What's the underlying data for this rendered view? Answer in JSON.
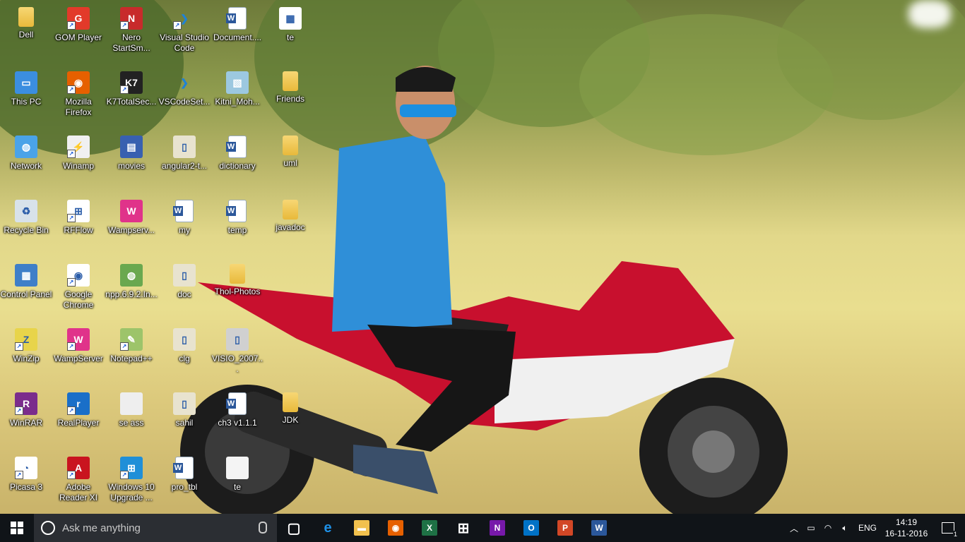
{
  "desktop": {
    "icons": [
      {
        "id": "dell",
        "label": "Dell",
        "icon": "folder-user-icon",
        "shortcut": false
      },
      {
        "id": "this-pc",
        "label": "This PC",
        "icon": "computer-icon",
        "shortcut": false
      },
      {
        "id": "network",
        "label": "Network",
        "icon": "network-icon",
        "shortcut": false
      },
      {
        "id": "recycle-bin",
        "label": "Recycle Bin",
        "icon": "recycle-bin-icon",
        "shortcut": false
      },
      {
        "id": "control-panel",
        "label": "Control Panel",
        "icon": "control-panel-icon",
        "shortcut": false
      },
      {
        "id": "winzip",
        "label": "WinZip",
        "icon": "winzip-icon",
        "shortcut": true
      },
      {
        "id": "winrar",
        "label": "WinRAR",
        "icon": "winrar-icon",
        "shortcut": true
      },
      {
        "id": "picasa",
        "label": "Picasa 3",
        "icon": "picasa-icon",
        "shortcut": true
      },
      {
        "id": "gom",
        "label": "GOM Player",
        "icon": "gom-player-icon",
        "shortcut": true
      },
      {
        "id": "firefox",
        "label": "Mozilla Firefox",
        "icon": "firefox-icon",
        "shortcut": true
      },
      {
        "id": "winamp",
        "label": "Winamp",
        "icon": "winamp-icon",
        "shortcut": true
      },
      {
        "id": "rfflow",
        "label": "RFFlow",
        "icon": "rfflow-icon",
        "shortcut": true
      },
      {
        "id": "chrome",
        "label": "Google Chrome",
        "icon": "chrome-icon",
        "shortcut": true
      },
      {
        "id": "wampserver",
        "label": "WampServer",
        "icon": "wampserver-icon",
        "shortcut": true
      },
      {
        "id": "realplayer",
        "label": "RealPlayer",
        "icon": "realplayer-icon",
        "shortcut": true
      },
      {
        "id": "adobe",
        "label": "Adobe Reader XI",
        "icon": "adobe-reader-icon",
        "shortcut": true
      },
      {
        "id": "nero",
        "label": "Nero StartSm...",
        "icon": "nero-icon",
        "shortcut": true
      },
      {
        "id": "k7",
        "label": "K7TotalSec...",
        "icon": "k7-icon",
        "shortcut": true
      },
      {
        "id": "movies",
        "label": "movies",
        "icon": "mkv-file-icon",
        "shortcut": false
      },
      {
        "id": "wampserv2",
        "label": "Wampserv...",
        "icon": "wampserver-icon",
        "shortcut": false
      },
      {
        "id": "npp-installer",
        "label": "npp.6.9.2.In...",
        "icon": "notepadpp-installer-icon",
        "shortcut": false
      },
      {
        "id": "notepadpp",
        "label": "Notepad++",
        "icon": "notepadpp-icon",
        "shortcut": true
      },
      {
        "id": "se-ass",
        "label": "se ass",
        "icon": "file-icon",
        "shortcut": false
      },
      {
        "id": "win10",
        "label": "Windows 10 Upgrade ...",
        "icon": "windows-upgrade-icon",
        "shortcut": true
      },
      {
        "id": "vscode",
        "label": "Visual Studio Code",
        "icon": "vscode-icon",
        "shortcut": true
      },
      {
        "id": "vscodeset",
        "label": "VSCodeSet...",
        "icon": "vscode-icon",
        "shortcut": false
      },
      {
        "id": "angular",
        "label": "angular2-t...",
        "icon": "zip-file-icon",
        "shortcut": false
      },
      {
        "id": "my",
        "label": "my",
        "icon": "word-doc-icon",
        "shortcut": false
      },
      {
        "id": "doc",
        "label": "doc",
        "icon": "zip-file-icon",
        "shortcut": false
      },
      {
        "id": "clg",
        "label": "clg",
        "icon": "zip-file-icon",
        "shortcut": false
      },
      {
        "id": "sahil",
        "label": "sahil",
        "icon": "zip-file-icon",
        "shortcut": false
      },
      {
        "id": "pro-tbl",
        "label": "pro_tbl",
        "icon": "vscode-file-icon",
        "shortcut": false
      },
      {
        "id": "document",
        "label": "Document....",
        "icon": "word-doc-icon",
        "shortcut": false
      },
      {
        "id": "kitni",
        "label": "Kitni_Moh...",
        "icon": "image-file-icon",
        "shortcut": false
      },
      {
        "id": "dictionary",
        "label": "dictionary",
        "icon": "word-doc-icon",
        "shortcut": false
      },
      {
        "id": "temp",
        "label": "temp",
        "icon": "word-doc-icon",
        "shortcut": false
      },
      {
        "id": "thol",
        "label": "Thol-Photos",
        "icon": "zip-folder-icon",
        "shortcut": false
      },
      {
        "id": "visio",
        "label": "VISIO_2007...",
        "icon": "installer-icon",
        "shortcut": false
      },
      {
        "id": "ch3",
        "label": "ch3 v1.1.1",
        "icon": "word-doc-icon",
        "shortcut": false
      },
      {
        "id": "te-file",
        "label": "te",
        "icon": "blank-file-icon",
        "shortcut": false
      },
      {
        "id": "te-img",
        "label": "te",
        "icon": "image-thumbnail-icon",
        "shortcut": false
      },
      {
        "id": "friends",
        "label": "Friends",
        "icon": "folder-icon",
        "shortcut": false
      },
      {
        "id": "uml",
        "label": "uml",
        "icon": "folder-icon",
        "shortcut": false
      },
      {
        "id": "javadoc",
        "label": "javadoc",
        "icon": "folder-icon",
        "shortcut": false
      },
      {
        "id": "jdk",
        "label": "JDK",
        "icon": "folder-icon",
        "shortcut": false
      }
    ]
  },
  "taskbar": {
    "search_placeholder": "Ask me anything",
    "apps": [
      {
        "id": "task-view",
        "icon": "task-view-icon",
        "color": "#ffffff"
      },
      {
        "id": "edge",
        "icon": "edge-icon",
        "color": "#1e90e6"
      },
      {
        "id": "file-explorer",
        "icon": "file-explorer-icon",
        "color": "#f2c14e"
      },
      {
        "id": "firefox",
        "icon": "firefox-icon",
        "color": "#e66000"
      },
      {
        "id": "excel",
        "icon": "excel-icon",
        "color": "#1e7145"
      },
      {
        "id": "store",
        "icon": "store-icon",
        "color": "#ffffff"
      },
      {
        "id": "onenote",
        "icon": "onenote-icon",
        "color": "#7719aa"
      },
      {
        "id": "outlook",
        "icon": "outlook-icon",
        "color": "#0072c6"
      },
      {
        "id": "powerpoint",
        "icon": "powerpoint-icon",
        "color": "#d24726"
      },
      {
        "id": "word",
        "icon": "word-icon",
        "color": "#2b579a"
      }
    ],
    "tray": {
      "language": "ENG",
      "time": "14:19",
      "date": "16-11-2016",
      "notification_count": "1"
    }
  }
}
